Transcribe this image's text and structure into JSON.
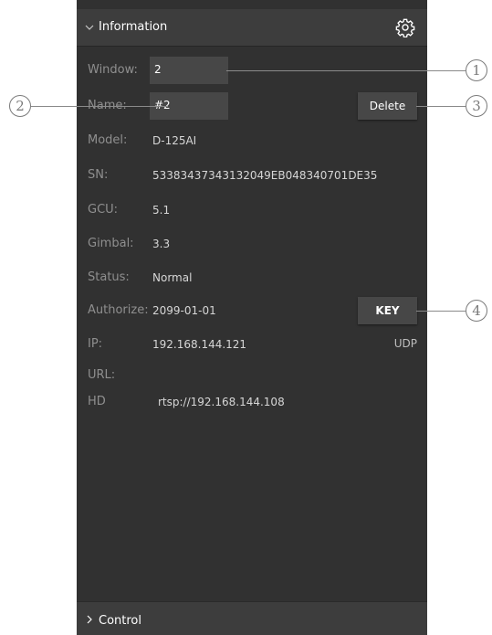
{
  "header": {
    "title": "Information"
  },
  "labels": {
    "window": "Window:",
    "name": "Name:",
    "model": "Model:",
    "sn": "SN:",
    "gcu": "GCU:",
    "gimbal": "Gimbal:",
    "status": "Status:",
    "authorize": "Authorize:",
    "ip": "IP:",
    "url": "URL:",
    "hd": "HD"
  },
  "values": {
    "window": "2",
    "name": "#2",
    "model": "D-125AI",
    "sn": "53383437343132049EB048340701DE35",
    "gcu": "5.1",
    "gimbal": "3.3",
    "status": "Normal",
    "authorize": "2099-01-01",
    "ip": "192.168.144.121",
    "protocol": "UDP",
    "hd_url": "rtsp://192.168.144.108"
  },
  "buttons": {
    "delete": "Delete",
    "key": "KEY"
  },
  "footer": {
    "title": "Control"
  },
  "callouts": [
    "1",
    "2",
    "3",
    "4"
  ],
  "icons": {
    "header_chevron": "chevron-down-icon",
    "settings": "gear-icon",
    "footer_chevron": "chevron-right-icon"
  }
}
